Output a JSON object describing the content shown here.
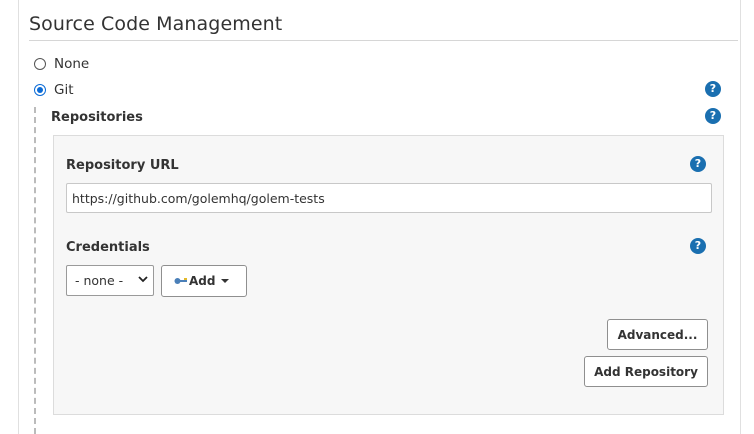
{
  "section": {
    "title": "Source Code Management"
  },
  "scm_options": [
    {
      "label": "None",
      "checked": false
    },
    {
      "label": "Git",
      "checked": true
    }
  ],
  "repositories": {
    "label": "Repositories",
    "url_label": "Repository URL",
    "url_value": "https://github.com/golemhq/golem-tests",
    "credentials_label": "Credentials",
    "credentials_selected": "- none -",
    "add_button_label": "Add",
    "advanced_button_label": "Advanced...",
    "add_repository_button_label": "Add Repository"
  },
  "help": {
    "glyph": "?"
  },
  "icons": {
    "help": "help-icon",
    "key": "key-icon",
    "caret": "chevron-down-icon"
  },
  "colors": {
    "help_icon": "#1a6fb0",
    "radio_checked": "#0b6bd6",
    "panel_bg": "#f7f7f7"
  }
}
